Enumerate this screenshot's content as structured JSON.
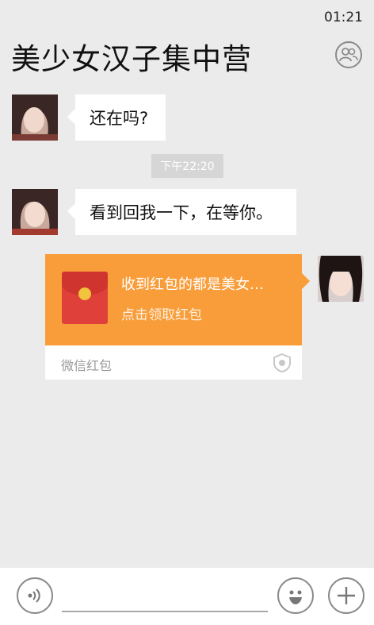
{
  "status": {
    "time": "01:21"
  },
  "header": {
    "title": "美少女汉子集中营",
    "group_icon": "group-members-icon"
  },
  "messages": [
    {
      "sender": "other",
      "avatar": "female-avatar",
      "text": "还在吗?"
    },
    {
      "type": "timestamp",
      "text": "下午22:20"
    },
    {
      "sender": "other",
      "avatar": "female-avatar",
      "text": "看到回我一下，在等你。"
    },
    {
      "sender": "me",
      "avatar": "female-avatar",
      "type": "red-packet",
      "title": "收到红包的都是美女…",
      "subtitle": "点击领取红包",
      "brand": "微信红包",
      "accent": "#f99d3a"
    }
  ],
  "input_bar": {
    "voice_icon": "voice-icon",
    "emoji_icon": "emoji-icon",
    "add_icon": "plus-icon",
    "placeholder": ""
  }
}
